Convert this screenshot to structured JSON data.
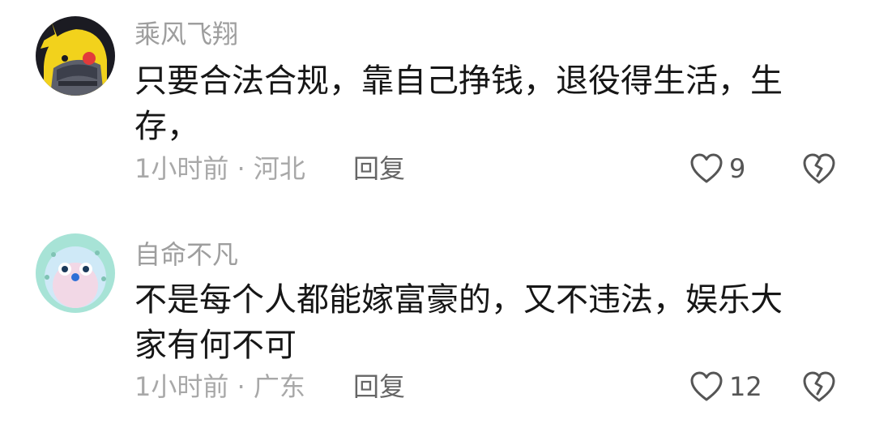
{
  "comments": [
    {
      "username": "乘风飞翔",
      "avatar_icon": "cartoon-pikachu-hood-avatar",
      "text": "只要合法合规，靠自己挣钱，退役得生活，生存，",
      "meta": "1小时前 · 河北",
      "reply_label": "回复",
      "like_count": "9",
      "like_icon": "heart-outline-icon",
      "dislike_icon": "broken-heart-icon"
    },
    {
      "username": "自命不凡",
      "avatar_icon": "cartoon-pufferfish-avatar",
      "text": "不是每个人都能嫁富豪的，又不违法，娱乐大家有何不可",
      "meta": "1小时前 · 广东",
      "reply_label": "回复",
      "like_count": "12",
      "like_icon": "heart-outline-icon",
      "dislike_icon": "broken-heart-icon"
    }
  ],
  "colors": {
    "username": "#9e9e9e",
    "text": "#161616",
    "meta": "#a8a8a8",
    "icon": "#555555"
  }
}
